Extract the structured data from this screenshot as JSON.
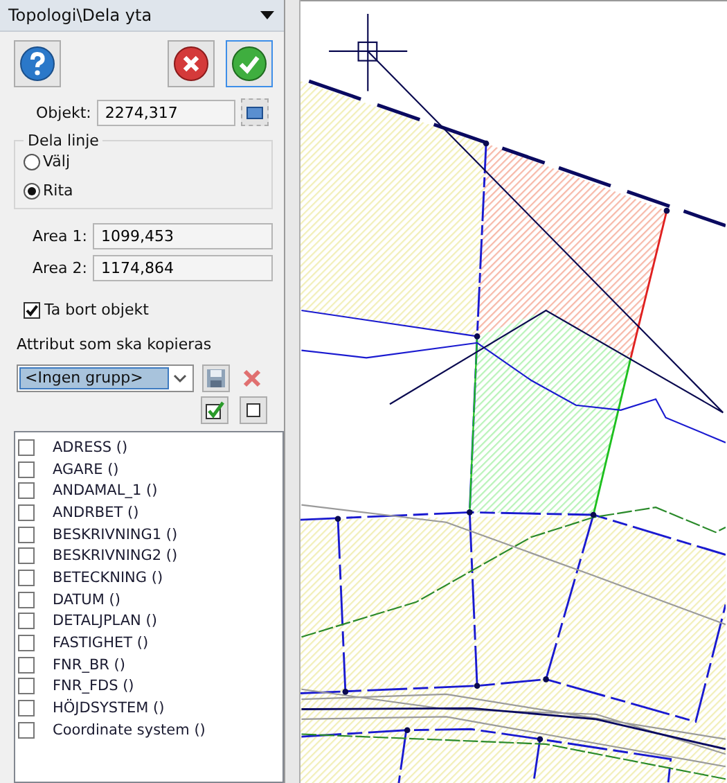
{
  "panel": {
    "title": "Topologi\\Dela yta"
  },
  "objekt": {
    "label": "Objekt:",
    "value": "2274,317"
  },
  "dela_linje": {
    "title": "Dela linje",
    "options": [
      {
        "label": "Välj",
        "selected": false
      },
      {
        "label": "Rita",
        "selected": true
      }
    ]
  },
  "areas": [
    {
      "label": "Area 1:",
      "value": "1099,453"
    },
    {
      "label": "Area 2:",
      "value": "1174,864"
    }
  ],
  "ta_bort": {
    "label": "Ta bort objekt",
    "checked": true
  },
  "attribut": {
    "title": "Attribut som ska kopieras",
    "group": "<Ingen grupp>",
    "items": [
      {
        "label": "ADRESS ()",
        "checked": false
      },
      {
        "label": "AGARE ()",
        "checked": false
      },
      {
        "label": "ANDAMAL_1 ()",
        "checked": false
      },
      {
        "label": "ANDRBET ()",
        "checked": false
      },
      {
        "label": "BESKRIVNING1 ()",
        "checked": false
      },
      {
        "label": "BESKRIVNING2 ()",
        "checked": false
      },
      {
        "label": "BETECKNING ()",
        "checked": false
      },
      {
        "label": "DATUM ()",
        "checked": false
      },
      {
        "label": "DETALJPLAN ()",
        "checked": false
      },
      {
        "label": "FASTIGHET ()",
        "checked": false
      },
      {
        "label": "FNR_BR ()",
        "checked": false
      },
      {
        "label": "FNR_FDS ()",
        "checked": false
      },
      {
        "label": "HÖJDSYSTEM ()",
        "checked": false
      },
      {
        "label": "Coordinate system ()",
        "checked": false
      }
    ]
  }
}
